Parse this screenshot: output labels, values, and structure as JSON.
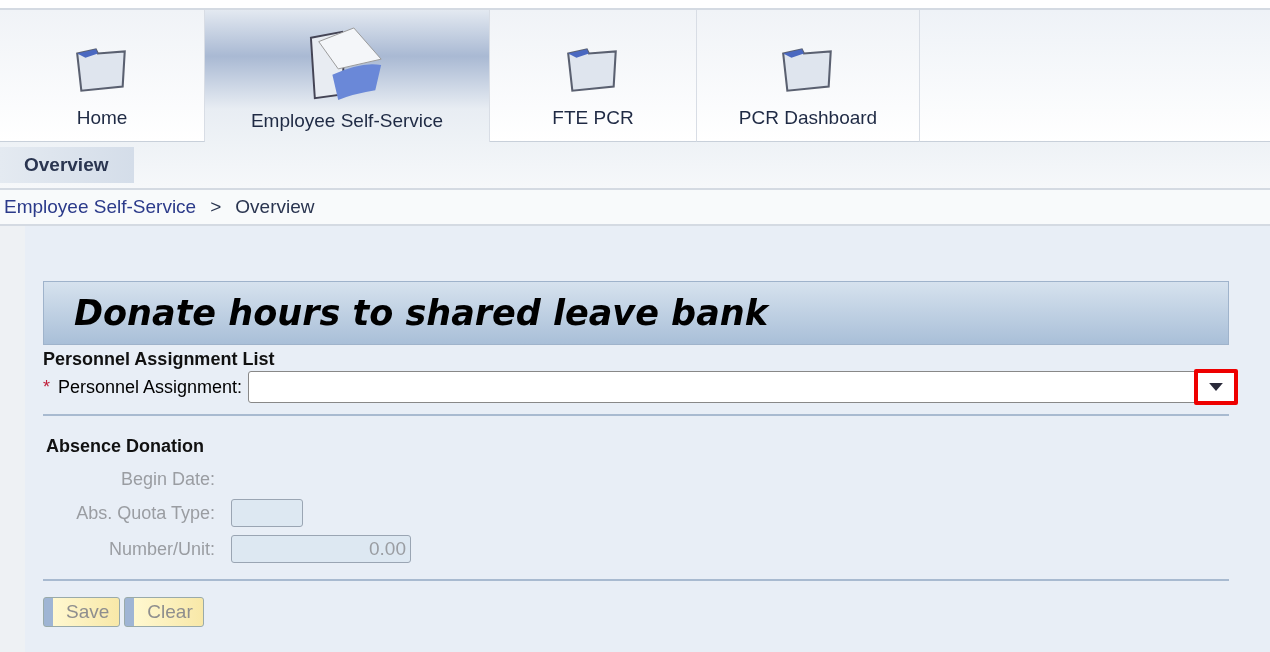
{
  "tabs": [
    {
      "label": "Home",
      "selected": false,
      "kind": "folder"
    },
    {
      "label": "Employee Self-Service",
      "selected": true,
      "kind": "documents"
    },
    {
      "label": "FTE PCR",
      "selected": false,
      "kind": "folder"
    },
    {
      "label": "PCR Dashboard",
      "selected": false,
      "kind": "folder"
    }
  ],
  "subnav": [
    {
      "label": "Overview",
      "selected": true
    }
  ],
  "breadcrumb": {
    "link": "Employee Self-Service",
    "separator": ">",
    "current": "Overview"
  },
  "form": {
    "title": "Donate hours to shared leave bank",
    "assignment_section": {
      "heading": "Personnel Assignment List",
      "label": "Personnel Assignment:",
      "required_mark": "*",
      "dropdown_highlighted": true
    },
    "donation_section": {
      "heading": "Absence Donation",
      "fields": [
        {
          "kind": "text",
          "label": "Begin Date:",
          "disabled": true
        },
        {
          "kind": "input",
          "label": "Abs. Quota Type:",
          "disabled": true
        },
        {
          "kind": "number",
          "label": "Number/Unit:",
          "value": "0.00",
          "disabled": true
        }
      ]
    },
    "buttons": [
      {
        "label": "Save",
        "disabled": true
      },
      {
        "label": "Clear",
        "disabled": true
      }
    ]
  }
}
